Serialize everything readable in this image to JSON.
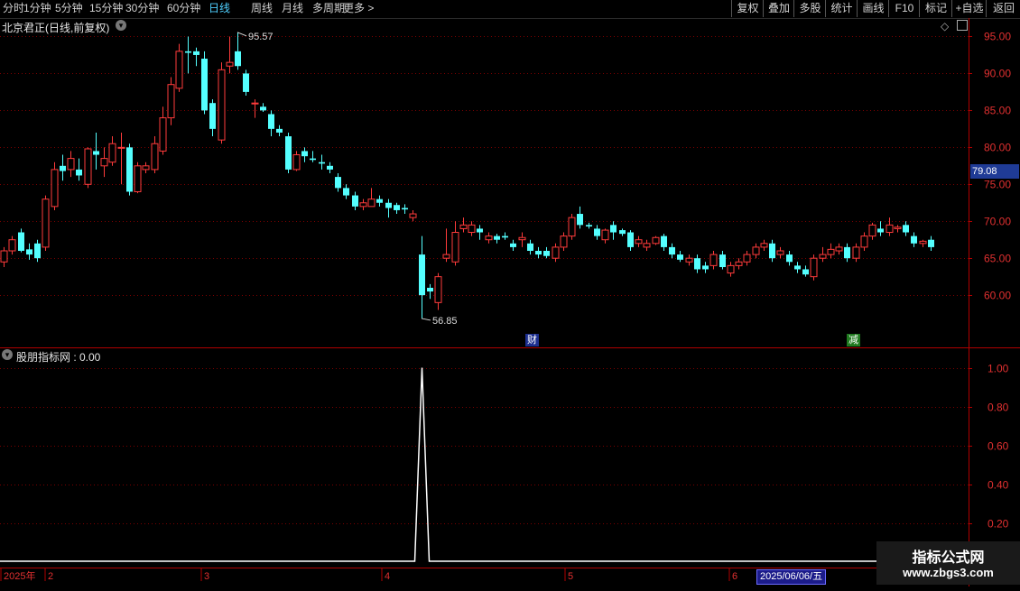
{
  "toolbar": {
    "left_items": [
      "分时",
      "1分钟",
      "5分钟",
      "15分钟",
      "30分钟",
      "60分钟",
      "日线",
      "周线",
      "月线",
      "多周期",
      "更多 >"
    ],
    "active": "日线",
    "right_items": [
      "复权",
      "叠加",
      "多股",
      "统计",
      "画线",
      "F10",
      "标记",
      "+自选",
      "返回"
    ]
  },
  "main_panel": {
    "title": "北京君正(日线,前复权)",
    "yaxis_ticks": [
      "95.00",
      "90.00",
      "85.00",
      "80.00",
      "75.00",
      "70.00",
      "65.00",
      "60.00"
    ],
    "last_price": "79.08",
    "high_label": "95.57",
    "low_label": "56.85",
    "markers": [
      "财",
      "减"
    ]
  },
  "indicator_panel": {
    "title": "股朋指标网 : 0.00",
    "yaxis_ticks": [
      "1.00",
      "0.80",
      "0.60",
      "0.40",
      "0.20"
    ]
  },
  "xaxis": {
    "labels": [
      "2025年",
      "2",
      "3",
      "4",
      "5",
      "6"
    ],
    "cursor_date": "2025/06/06/五"
  },
  "watermark": {
    "line1": "指标公式网",
    "line2": "www.zbgs3.com"
  },
  "colors": {
    "up": "#ff3b3b",
    "down": "#54ffff",
    "grid": "#7a0000",
    "axis": "#b00000"
  },
  "chart_data": {
    "type": "candlestick",
    "ylim": [
      55.5,
      97.5
    ],
    "candles": [
      [
        64.5,
        66.0,
        63.8,
        66.5
      ],
      [
        66.0,
        67.5,
        65.5,
        68.0
      ],
      [
        68.5,
        66.0,
        65.8,
        69.0
      ],
      [
        66.2,
        65.5,
        64.8,
        67.0
      ],
      [
        67.0,
        65.0,
        64.5,
        67.5
      ],
      [
        66.5,
        73.0,
        66.0,
        73.5
      ],
      [
        72.0,
        77.0,
        71.5,
        78.0
      ],
      [
        77.5,
        76.8,
        75.5,
        79.0
      ],
      [
        77.0,
        78.5,
        76.0,
        79.5
      ],
      [
        77.0,
        76.2,
        75.5,
        78.5
      ],
      [
        75.0,
        79.8,
        74.5,
        80.0
      ],
      [
        79.5,
        79.0,
        77.0,
        82.0
      ],
      [
        77.5,
        78.5,
        76.0,
        80.0
      ],
      [
        78.0,
        80.5,
        77.5,
        81.5
      ],
      [
        80.0,
        80.0,
        75.0,
        82.0
      ],
      [
        80.0,
        74.0,
        73.5,
        80.5
      ],
      [
        74.0,
        77.5,
        73.8,
        78.0
      ],
      [
        77.0,
        77.5,
        76.5,
        78.0
      ],
      [
        77.0,
        80.5,
        76.5,
        81.5
      ],
      [
        79.5,
        84.0,
        79.0,
        85.5
      ],
      [
        84.0,
        88.5,
        83.0,
        89.5
      ],
      [
        88.0,
        93.0,
        87.5,
        94.0
      ],
      [
        93.0,
        92.8,
        90.0,
        95.0
      ],
      [
        93.0,
        92.5,
        91.0,
        93.5
      ],
      [
        92.0,
        85.0,
        84.5,
        93.0
      ],
      [
        86.0,
        82.5,
        81.5,
        86.5
      ],
      [
        81.0,
        90.5,
        80.5,
        91.5
      ],
      [
        91.0,
        91.5,
        90.0,
        95.0
      ],
      [
        93.0,
        91.0,
        90.5,
        95.57
      ],
      [
        90.0,
        87.5,
        87.0,
        90.5
      ],
      [
        86.0,
        86.0,
        84.0,
        86.5
      ],
      [
        85.5,
        85.0,
        84.8,
        86.0
      ],
      [
        84.5,
        82.5,
        81.5,
        85.0
      ],
      [
        82.5,
        82.0,
        81.5,
        83.0
      ],
      [
        81.5,
        77.0,
        76.5,
        82.0
      ],
      [
        77.0,
        79.0,
        76.8,
        79.5
      ],
      [
        79.5,
        78.8,
        78.0,
        80.0
      ],
      [
        78.5,
        78.3,
        78.0,
        79.5
      ],
      [
        78.0,
        77.8,
        77.0,
        79.0
      ],
      [
        77.5,
        77.0,
        76.5,
        78.0
      ],
      [
        76.0,
        74.5,
        74.0,
        76.5
      ],
      [
        74.5,
        73.5,
        73.0,
        75.0
      ],
      [
        73.5,
        72.0,
        71.5,
        74.0
      ],
      [
        72.0,
        72.5,
        71.5,
        73.0
      ],
      [
        72.0,
        73.0,
        72.0,
        74.5
      ],
      [
        73.0,
        72.5,
        72.0,
        73.5
      ],
      [
        72.5,
        71.8,
        70.5,
        73.0
      ],
      [
        72.2,
        71.5,
        71.0,
        72.5
      ],
      [
        71.8,
        71.6,
        71.0,
        72.3
      ],
      [
        70.5,
        71.0,
        70.0,
        71.5
      ],
      [
        65.5,
        60.0,
        56.85,
        68.0
      ],
      [
        61.0,
        60.5,
        59.5,
        61.5
      ],
      [
        59.0,
        62.5,
        58.0,
        63.0
      ],
      [
        65.0,
        65.5,
        64.5,
        69.0
      ],
      [
        64.5,
        68.5,
        64.0,
        70.0
      ],
      [
        69.0,
        69.5,
        68.5,
        70.5
      ],
      [
        68.5,
        69.5,
        68.0,
        70.0
      ],
      [
        69.0,
        68.5,
        67.5,
        69.5
      ],
      [
        67.5,
        68.0,
        67.0,
        68.5
      ],
      [
        68.0,
        67.5,
        67.0,
        68.3
      ],
      [
        68.0,
        67.8,
        67.5,
        68.5
      ],
      [
        67.0,
        66.5,
        66.0,
        67.5
      ],
      [
        67.5,
        67.8,
        66.5,
        68.5
      ],
      [
        67.0,
        66.0,
        65.5,
        67.5
      ],
      [
        66.0,
        65.5,
        65.0,
        66.5
      ],
      [
        66.0,
        65.3,
        65.0,
        66.5
      ],
      [
        65.0,
        66.5,
        64.5,
        67.0
      ],
      [
        66.5,
        68.0,
        66.0,
        68.5
      ],
      [
        68.0,
        70.5,
        67.5,
        71.0
      ],
      [
        71.0,
        69.5,
        69.0,
        72.0
      ],
      [
        69.5,
        69.3,
        69.0,
        69.8
      ],
      [
        69.0,
        68.0,
        67.5,
        69.5
      ],
      [
        67.5,
        68.8,
        67.0,
        69.0
      ],
      [
        69.5,
        68.5,
        67.5,
        70.0
      ],
      [
        68.8,
        68.3,
        68.0,
        69.0
      ],
      [
        68.5,
        66.5,
        66.0,
        68.8
      ],
      [
        67.0,
        67.5,
        66.5,
        68.0
      ],
      [
        66.5,
        67.0,
        66.0,
        67.5
      ],
      [
        67.0,
        67.8,
        66.8,
        68.0
      ],
      [
        68.0,
        66.5,
        66.0,
        68.3
      ],
      [
        66.5,
        65.5,
        65.0,
        67.0
      ],
      [
        65.5,
        64.8,
        64.5,
        66.0
      ],
      [
        64.5,
        65.0,
        64.0,
        65.5
      ],
      [
        65.0,
        63.5,
        63.0,
        65.5
      ],
      [
        64.0,
        63.5,
        63.0,
        64.5
      ],
      [
        64.0,
        65.5,
        63.5,
        66.0
      ],
      [
        65.5,
        63.8,
        63.5,
        66.0
      ],
      [
        63.0,
        64.0,
        62.5,
        64.5
      ],
      [
        64.0,
        64.5,
        63.5,
        65.0
      ],
      [
        64.5,
        65.5,
        64.0,
        66.0
      ],
      [
        65.5,
        66.5,
        65.0,
        67.0
      ],
      [
        66.5,
        67.0,
        66.0,
        67.5
      ],
      [
        67.0,
        65.0,
        64.5,
        67.5
      ],
      [
        65.5,
        66.0,
        65.0,
        66.5
      ],
      [
        65.5,
        64.5,
        64.0,
        66.0
      ],
      [
        64.0,
        63.5,
        63.0,
        64.5
      ],
      [
        63.5,
        62.8,
        62.5,
        64.0
      ],
      [
        62.5,
        65.0,
        62.0,
        65.5
      ],
      [
        65.0,
        65.5,
        64.5,
        66.5
      ],
      [
        65.5,
        66.2,
        65.0,
        67.0
      ],
      [
        66.0,
        66.5,
        65.5,
        67.0
      ],
      [
        66.5,
        65.0,
        64.5,
        67.0
      ],
      [
        65.0,
        66.5,
        64.5,
        67.0
      ],
      [
        66.5,
        68.0,
        66.0,
        68.5
      ],
      [
        68.0,
        69.5,
        67.5,
        69.8
      ],
      [
        69.0,
        68.5,
        68.0,
        70.0
      ],
      [
        68.5,
        69.5,
        68.0,
        70.5
      ],
      [
        69.0,
        69.2,
        68.5,
        69.5
      ],
      [
        69.5,
        68.5,
        68.0,
        70.0
      ],
      [
        68.0,
        67.0,
        66.5,
        68.5
      ],
      [
        67.0,
        67.3,
        66.5,
        67.5
      ],
      [
        67.5,
        66.5,
        66.0,
        68.0
      ]
    ],
    "indicator": {
      "name": "股朋指标网",
      "ylim": [
        0,
        1.1
      ],
      "spike_index": 50,
      "spike_value": 1.0,
      "base_value": 0.0
    }
  }
}
